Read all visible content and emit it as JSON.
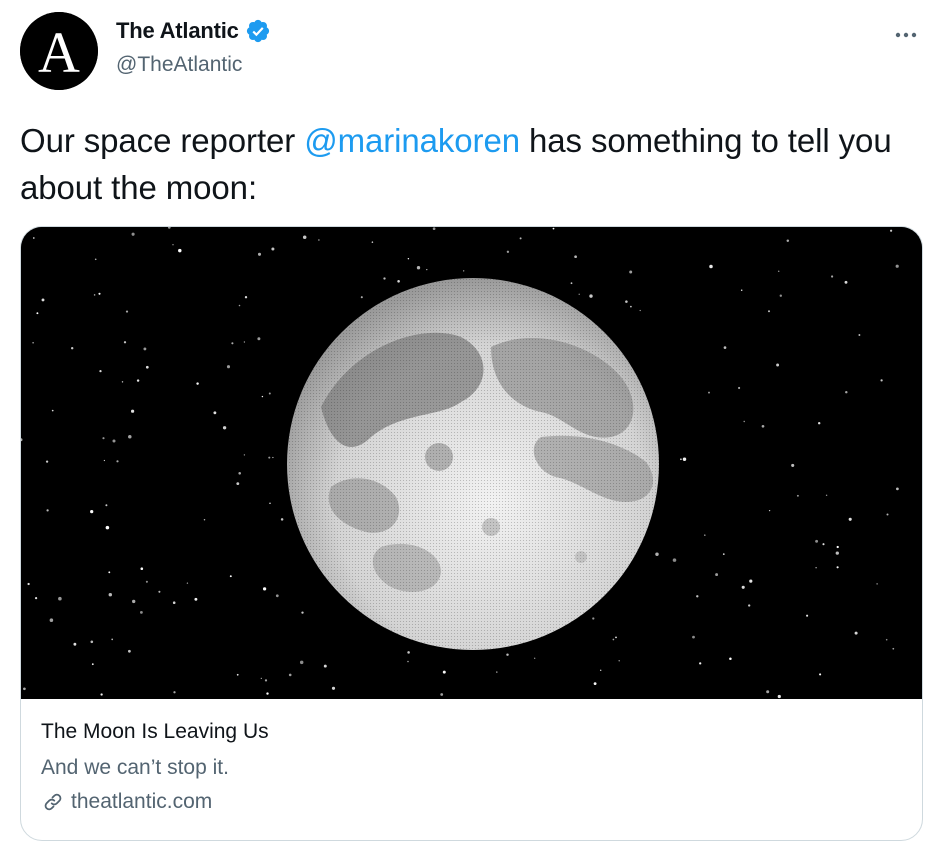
{
  "author": {
    "display_name": "The Atlantic",
    "handle": "@TheAtlantic",
    "avatar_letter": "A",
    "verified": true,
    "verified_icon": "verified-badge-icon",
    "verified_color": "#1d9bf0"
  },
  "more_icon": "more-options-icon",
  "tweet": {
    "text_before": "Our space reporter ",
    "mention": "@marinakoren",
    "text_after": " has something to tell you about the moon:",
    "mention_color": "#1d9bf0"
  },
  "card": {
    "image_alt": "full moon in a starry night sky",
    "title": "The Moon Is Leaving Us",
    "description": "And we can’t stop it.",
    "domain": "theatlantic.com",
    "link_icon": "link-icon"
  },
  "colors": {
    "text_primary": "#0f1419",
    "text_secondary": "#536471",
    "border": "#cfd9de"
  }
}
